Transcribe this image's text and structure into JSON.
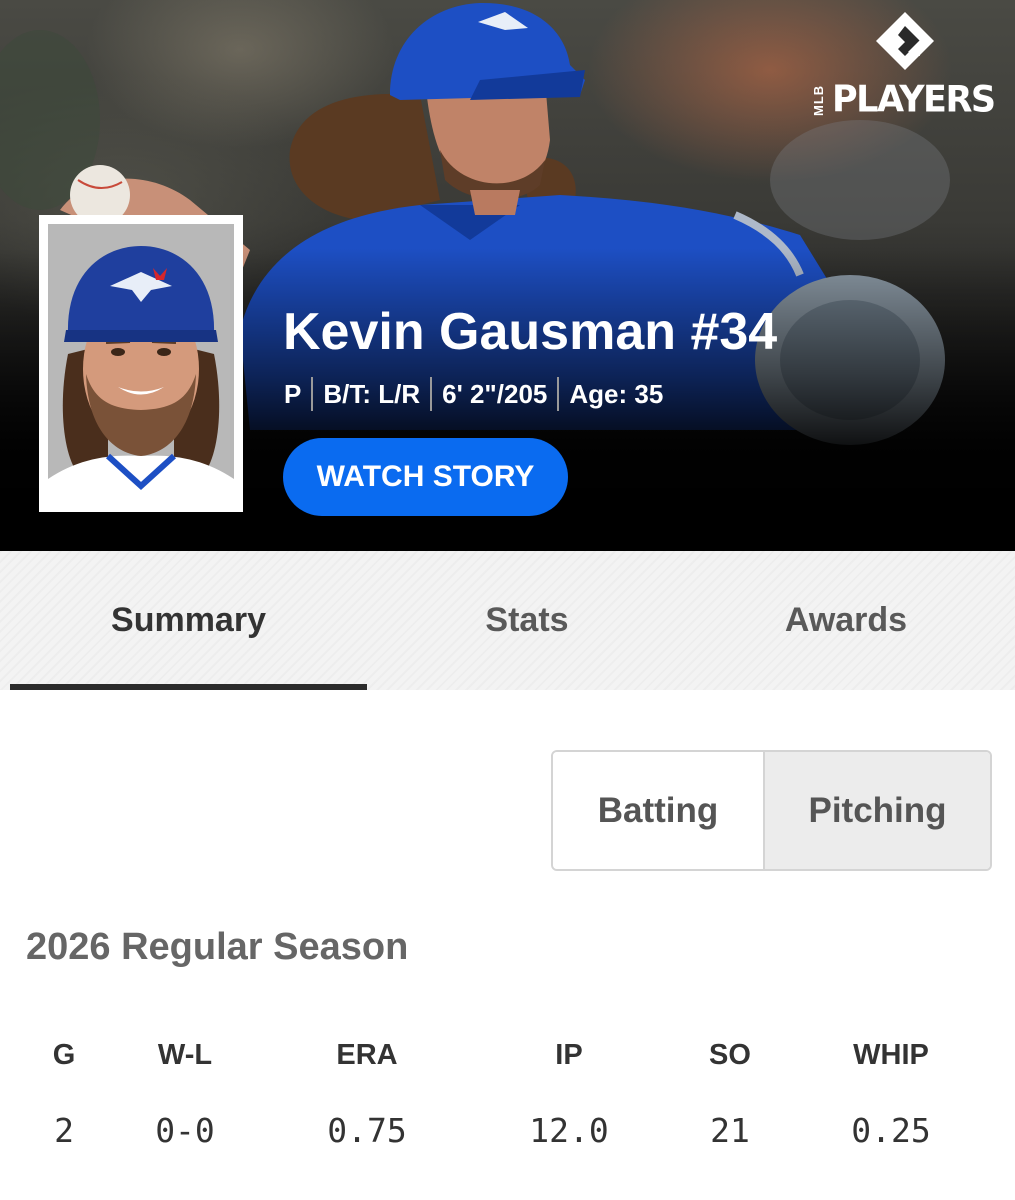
{
  "brand": {
    "logo_text": "PLAYERS",
    "logo_sub": "MLB"
  },
  "player": {
    "name": "Kevin Gausman #34",
    "position": "P",
    "bats_throws": "B/T: L/R",
    "height_weight": "6' 2\"/205",
    "age": "Age: 35"
  },
  "hero": {
    "watch_label": "WATCH STORY"
  },
  "tabs": [
    {
      "label": "Summary",
      "active": true
    },
    {
      "label": "Stats",
      "active": false
    },
    {
      "label": "Awards",
      "active": false
    }
  ],
  "stat_type": {
    "options": [
      "Batting",
      "Pitching"
    ],
    "selected": "Pitching"
  },
  "season": {
    "title": "2026 Regular Season",
    "columns": [
      {
        "head": "G",
        "value": "2"
      },
      {
        "head": "W-L",
        "value": "0-0"
      },
      {
        "head": "ERA",
        "value": "0.75"
      },
      {
        "head": "IP",
        "value": "12.0"
      },
      {
        "head": "SO",
        "value": "21"
      },
      {
        "head": "WHIP",
        "value": "0.25"
      }
    ]
  },
  "colors": {
    "accent": "#0a6bf0",
    "team_blue": "#1d4fc4",
    "tab_underline": "#2b2b2b"
  }
}
